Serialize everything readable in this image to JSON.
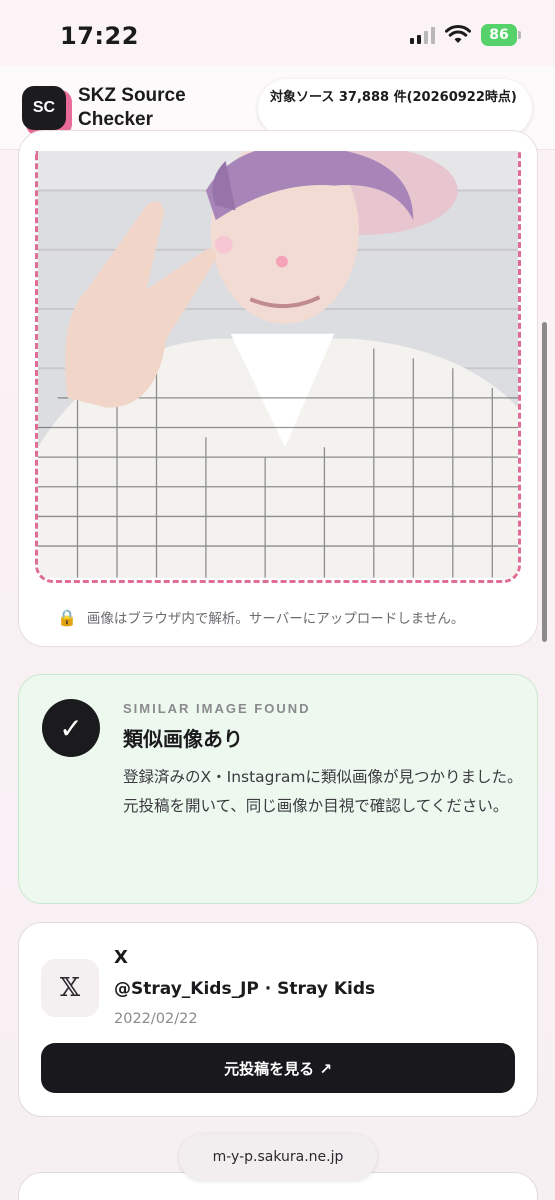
{
  "status_bar": {
    "time": "17:22",
    "battery": "86"
  },
  "header": {
    "logo_text": "SC",
    "title": "SKZ Source Checker",
    "source_count": "対象ソース 37,888 件(20260922時点)"
  },
  "upload": {
    "privacy_note": "画像はブラウザ内で解析。サーバーにアップロードしません。"
  },
  "result": {
    "eyebrow": "SIMILAR IMAGE FOUND",
    "title": "類似画像あり",
    "body_line1": "登録済みのX・Instagramに類似画像が見つかりました。",
    "body_line2": "元投稿を開いて、同じ画像か目視で確認してください。"
  },
  "match": {
    "platform_icon": "x-logo",
    "platform": "X",
    "account": "@Stray_Kids_JP · Stray Kids",
    "date": "2022/02/22",
    "button_label": "元投稿を見る ↗"
  },
  "browser": {
    "url": "m-y-p.sakura.ne.jp"
  },
  "colors": {
    "accent_pink": "#e06d95",
    "success_bg": "#edf9ef",
    "dark": "#19181c"
  }
}
